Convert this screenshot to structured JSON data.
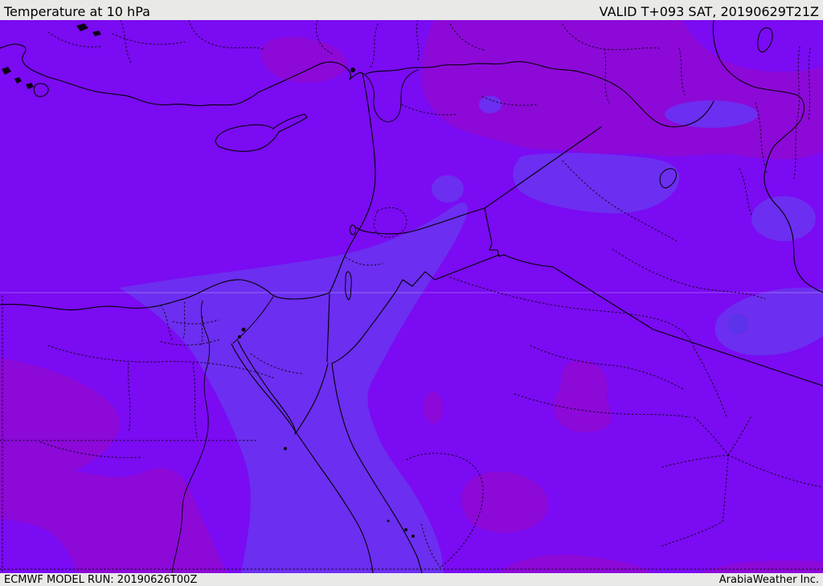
{
  "header": {
    "title": "Temperature at 10 hPa",
    "valid_label": "VALID T+093 SAT, 20190629T21Z"
  },
  "footer": {
    "model_run": "ECMWF MODEL RUN: 20190626T00Z",
    "provider": "ArabiaWeather Inc."
  },
  "map": {
    "palette": {
      "base": "#7a0bf2",
      "warm": "#8c09d8",
      "cool": "#6c2ef0",
      "cool2": "#5c33ea",
      "bar_bg": "#e9e9e8",
      "bar_text": "#000000",
      "outline": "#000000",
      "gridline": "#ffffff"
    }
  }
}
